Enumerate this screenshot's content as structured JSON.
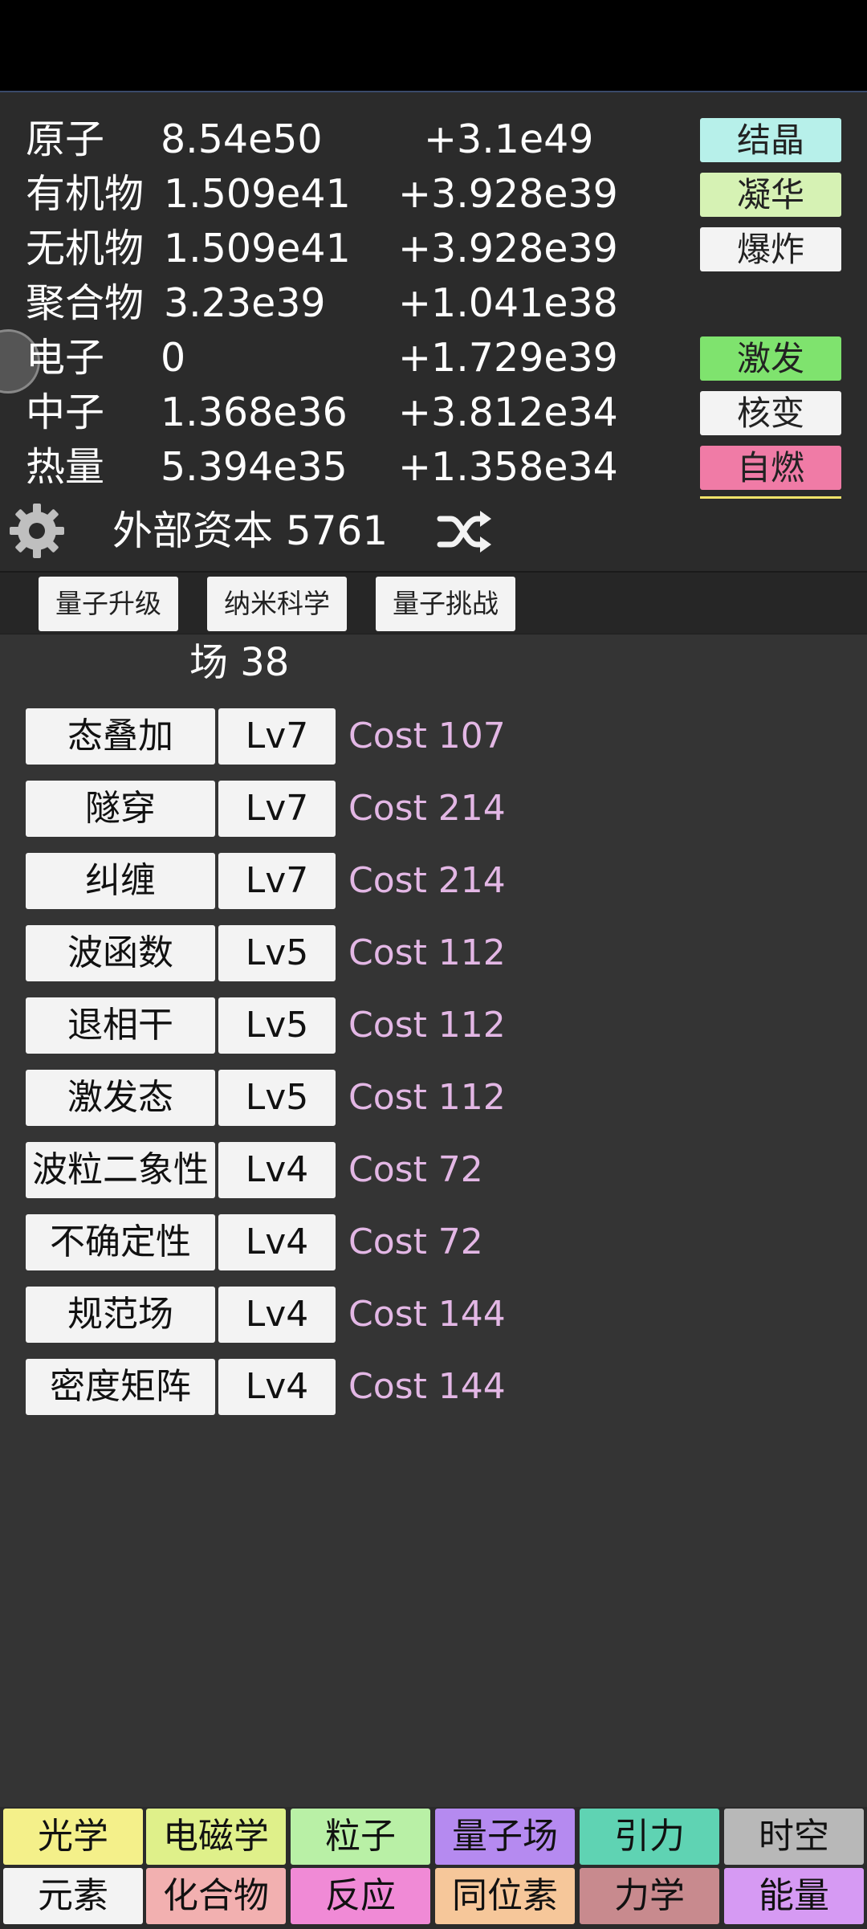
{
  "resources": [
    {
      "name": "原子",
      "amount": "8.54e50",
      "rate": "+3.1e49"
    },
    {
      "name": "有机物",
      "amount": "1.509e41",
      "rate": "+3.928e39"
    },
    {
      "name": "无机物",
      "amount": "1.509e41",
      "rate": "+3.928e39"
    },
    {
      "name": "聚合物",
      "amount": "3.23e39",
      "rate": "+1.041e38"
    },
    {
      "name": "电子",
      "amount": "0",
      "rate": "+1.729e39"
    },
    {
      "name": "中子",
      "amount": "1.368e36",
      "rate": "+3.812e34"
    },
    {
      "name": "热量",
      "amount": "5.394e35",
      "rate": "+1.358e34"
    }
  ],
  "actions": [
    {
      "label": "结晶",
      "color": "#b7f0ea"
    },
    {
      "label": "凝华",
      "color": "#d6f2b4"
    },
    {
      "label": "爆炸",
      "color": "#f3f3f3"
    },
    {
      "label": "激发",
      "color": "#7fe36e"
    },
    {
      "label": "核变",
      "color": "#f3f3f3"
    },
    {
      "label": "自燃",
      "color": "#f07ba6"
    }
  ],
  "capital": {
    "label": "外部资本 5761"
  },
  "sub_tabs": [
    {
      "label": "量子升级"
    },
    {
      "label": "纳米科学"
    },
    {
      "label": "量子挑战"
    }
  ],
  "field": {
    "title": "场 38"
  },
  "upgrades": [
    {
      "name": "态叠加",
      "level": "Lv7",
      "cost": "Cost 107"
    },
    {
      "name": "隧穿",
      "level": "Lv7",
      "cost": "Cost 214"
    },
    {
      "name": "纠缠",
      "level": "Lv7",
      "cost": "Cost 214"
    },
    {
      "name": "波函数",
      "level": "Lv5",
      "cost": "Cost 112"
    },
    {
      "name": "退相干",
      "level": "Lv5",
      "cost": "Cost 112"
    },
    {
      "name": "激发态",
      "level": "Lv5",
      "cost": "Cost 112"
    },
    {
      "name": "波粒二象性",
      "level": "Lv4",
      "cost": "Cost 72"
    },
    {
      "name": "不确定性",
      "level": "Lv4",
      "cost": "Cost 72"
    },
    {
      "name": "规范场",
      "level": "Lv4",
      "cost": "Cost 144"
    },
    {
      "name": "密度矩阵",
      "level": "Lv4",
      "cost": "Cost 144"
    }
  ],
  "categories_row1": [
    {
      "label": "光学",
      "color": "#f4f08a"
    },
    {
      "label": "电磁学",
      "color": "#dff08a"
    },
    {
      "label": "粒子",
      "color": "#b9f0a6"
    },
    {
      "label": "量子场",
      "color": "#b58af0"
    },
    {
      "label": "引力",
      "color": "#5fd3b3"
    },
    {
      "label": "时空",
      "color": "#b8b8b8"
    }
  ],
  "categories_row2": [
    {
      "label": "元素",
      "color": "#f3f3f3"
    },
    {
      "label": "化合物",
      "color": "#f2b0b0"
    },
    {
      "label": "反应",
      "color": "#f08ad6"
    },
    {
      "label": "同位素",
      "color": "#f6c79a"
    },
    {
      "label": "力学",
      "color": "#c88a8e"
    },
    {
      "label": "能量",
      "color": "#d69af3"
    }
  ]
}
